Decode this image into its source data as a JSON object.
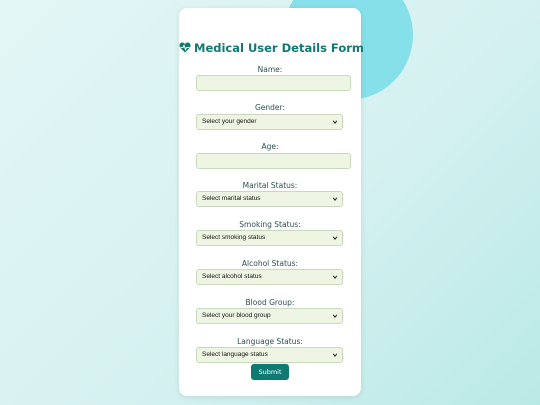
{
  "form": {
    "title": "Medical User Details Form",
    "icon": "heart-pulse-icon",
    "fields": {
      "name": {
        "label": "Name:",
        "value": ""
      },
      "gender": {
        "label": "Gender:",
        "selected": "Select your gender"
      },
      "age": {
        "label": "Age:",
        "value": ""
      },
      "marital": {
        "label": "Marital Status:",
        "selected": "Select marital status"
      },
      "smoking": {
        "label": "Smoking Status:",
        "selected": "Select smoking status"
      },
      "alcohol": {
        "label": "Alcohol Status:",
        "selected": "Select alcohol status"
      },
      "blood": {
        "label": "Blood Group:",
        "selected": "Select your blood group"
      },
      "language": {
        "label": "Language Status:",
        "selected": "Select language status"
      }
    },
    "submit_label": "Submit"
  },
  "colors": {
    "accent": "#0f7a72",
    "input_bg": "#eef6e3",
    "background_circle": "#86e0ea"
  }
}
